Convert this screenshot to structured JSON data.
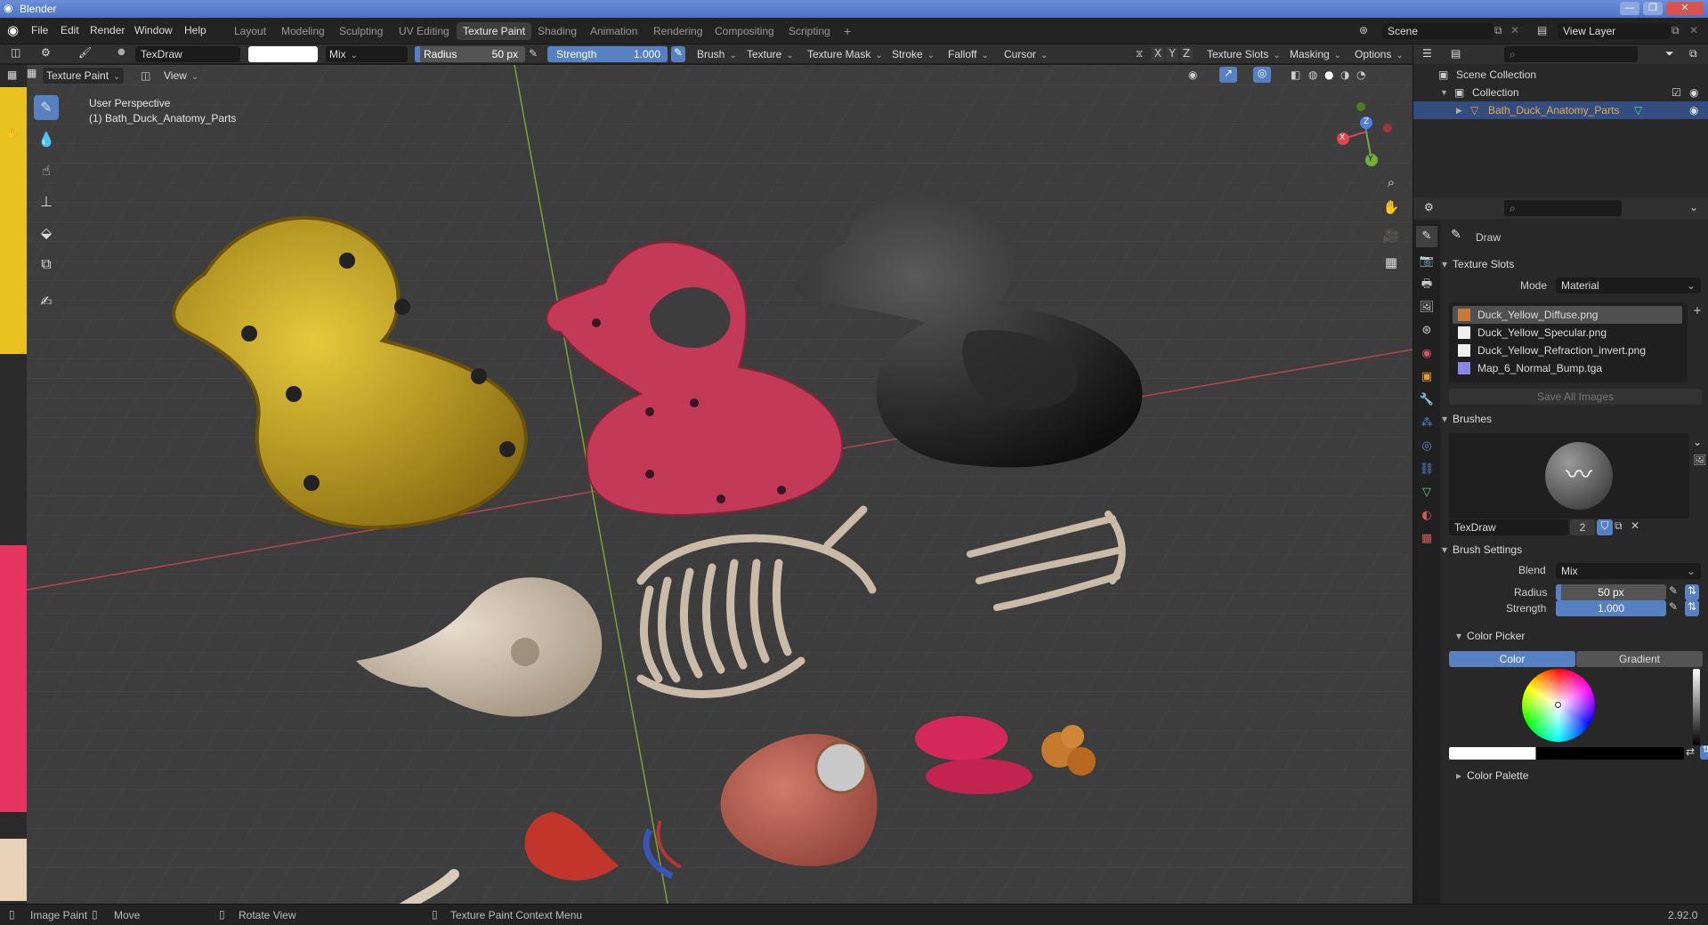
{
  "window": {
    "title": "Blender",
    "controls": [
      "—",
      "❐",
      "✕"
    ]
  },
  "menu": [
    "File",
    "Edit",
    "Render",
    "Window",
    "Help"
  ],
  "workspaces": [
    "Layout",
    "Modeling",
    "Sculpting",
    "UV Editing",
    "Texture Paint",
    "Shading",
    "Animation",
    "Rendering",
    "Compositing",
    "Scripting",
    "+"
  ],
  "active_workspace": "Texture Paint",
  "scene": {
    "scene_name": "Scene",
    "view_layer": "View Layer"
  },
  "tool_header": {
    "brush_name": "TexDraw",
    "blend": "Mix",
    "radius_label": "Radius",
    "radius_value": "50 px",
    "strength_label": "Strength",
    "strength_value": "1.000",
    "menus": [
      "Brush",
      "Texture",
      "Texture Mask",
      "Stroke",
      "Falloff",
      "Cursor"
    ],
    "axes": [
      "X",
      "Y",
      "Z"
    ],
    "right_menus": [
      "Texture Slots",
      "Masking",
      "Options"
    ]
  },
  "viewport_header": {
    "mode": "Texture Paint",
    "view": "View"
  },
  "viewport": {
    "perspective": "User Perspective",
    "object_label": "(1) Bath_Duck_Anatomy_Parts",
    "gizmo": {
      "x": "X",
      "y": "Y",
      "z": "Z"
    }
  },
  "outliner": {
    "scene_collection": "Scene Collection",
    "collection": "Collection",
    "object": "Bath_Duck_Anatomy_Parts"
  },
  "properties": {
    "tool_name": "Draw",
    "texture_slots_title": "Texture Slots",
    "mode_label": "Mode",
    "mode_value": "Material",
    "slots": [
      "Duck_Yellow_Diffuse.png",
      "Duck_Yellow_Specular.png",
      "Duck_Yellow_Refraction_invert.png",
      "Map_6_Normal_Bump.tga"
    ],
    "save_all": "Save All Images",
    "brushes_title": "Brushes",
    "brush_name": "TexDraw",
    "brush_users": "2",
    "brush_settings_title": "Brush Settings",
    "blend_label": "Blend",
    "blend_value": "Mix",
    "radius_label": "Radius",
    "radius_value": "50 px",
    "strength_label": "Strength",
    "strength_value": "1.000",
    "color_picker_title": "Color Picker",
    "color_tab": "Color",
    "gradient_tab": "Gradient",
    "color_palette_title": "Color Palette"
  },
  "statusbar": {
    "image_paint": "Image Paint",
    "move": "Move",
    "rotate": "Rotate View",
    "context_menu": "Texture Paint Context Menu",
    "version": "2.92.0"
  },
  "colors": {
    "accent": "#5680c2",
    "selected_row": "#334d80",
    "duck_yellow": "#c8a621",
    "shell_red": "#c23a58",
    "duck_black": "#1f1f1f",
    "bone": "#c9bba7"
  }
}
